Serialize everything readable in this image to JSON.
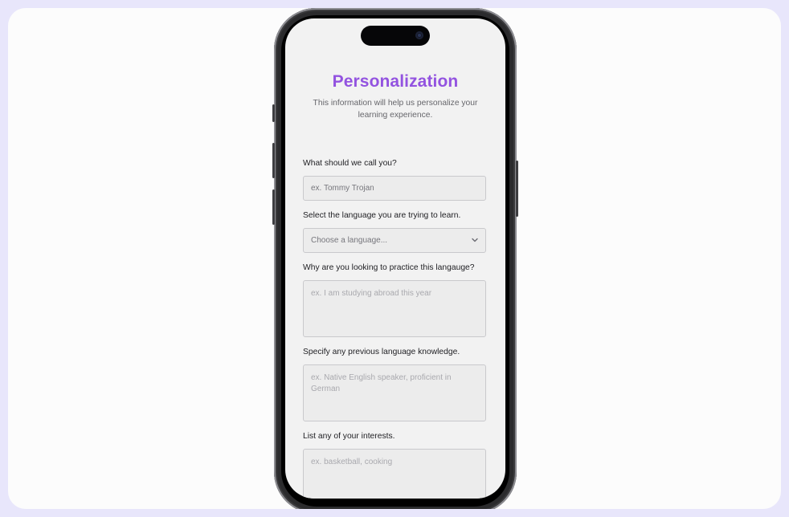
{
  "page": {
    "title": "Personalization",
    "subtitle": "This information will help us personalize your learning experience."
  },
  "form": {
    "name": {
      "label": "What should we call you?",
      "placeholder": "ex. Tommy Trojan"
    },
    "language": {
      "label": "Select the language you are trying to learn.",
      "selected": "Choose a language..."
    },
    "reason": {
      "label": "Why are you looking to practice this langauge?",
      "placeholder": "ex. I am studying abroad this year"
    },
    "knowledge": {
      "label": "Specify any previous language knowledge.",
      "placeholder": "ex. Native English speaker, proficient in German"
    },
    "interests": {
      "label": "List any of your interests.",
      "placeholder": "ex. basketball, cooking"
    }
  },
  "icons": {
    "dropdown": "chevron-down-icon"
  },
  "colors": {
    "accent": "#9353e0",
    "outer_background": "#e8e6fb",
    "screen_background": "#f2f2f2"
  }
}
